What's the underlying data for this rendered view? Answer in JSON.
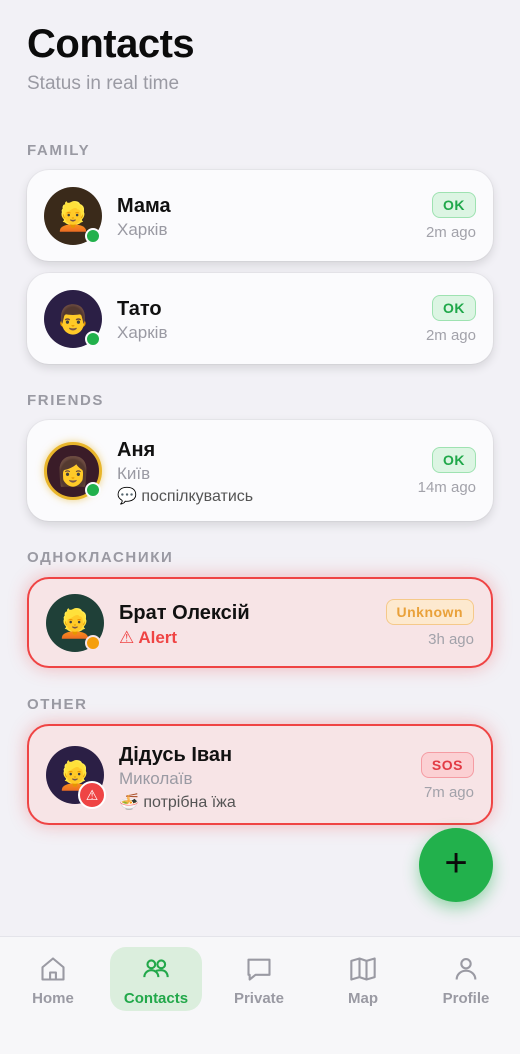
{
  "header": {
    "title": "Contacts",
    "subtitle": "Status in real time"
  },
  "sections": {
    "family": "FAMILY",
    "friends": "FRIENDS",
    "classmates": "ОДНОКЛАСНИКИ",
    "other": "OTHER"
  },
  "contacts": [
    {
      "name": "Мама",
      "city": "Харків",
      "status": "OK",
      "time": "2m ago",
      "avatar": "👱",
      "dot_color": "#22b14c"
    },
    {
      "name": "Тато",
      "city": "Харків",
      "status": "OK",
      "time": "2m ago",
      "avatar": "👨",
      "dot_color": "#22b14c"
    },
    {
      "name": "Аня",
      "city": "Київ",
      "note": "💬 поспілкуватись",
      "status": "OK",
      "time": "14m ago",
      "avatar": "👩",
      "dot_color": "#22b14c"
    },
    {
      "name": "Брат Олексій",
      "alert": "⚠ Alert",
      "status": "Unknown",
      "time": "3h ago",
      "avatar": "👱",
      "dot_color": "#f59e0b"
    },
    {
      "name": "Дідусь Іван",
      "city": "Миколаїв",
      "note": "🍜 потрібна їжа",
      "status": "SOS",
      "time": "7m ago",
      "avatar": "👱",
      "warn_icon": "⚠"
    }
  ],
  "fab": {
    "label": "+"
  },
  "tabs": [
    {
      "label": "Home",
      "icon": "home-icon"
    },
    {
      "label": "Contacts",
      "icon": "contacts-icon",
      "active": true
    },
    {
      "label": "Private",
      "icon": "chat-icon"
    },
    {
      "label": "Map",
      "icon": "map-icon"
    },
    {
      "label": "Profile",
      "icon": "profile-icon"
    }
  ],
  "colors": {
    "accent": "#22b14c",
    "alert": "#ef4444",
    "unknown": "#e9a13a",
    "background": "#f2f1f6"
  }
}
